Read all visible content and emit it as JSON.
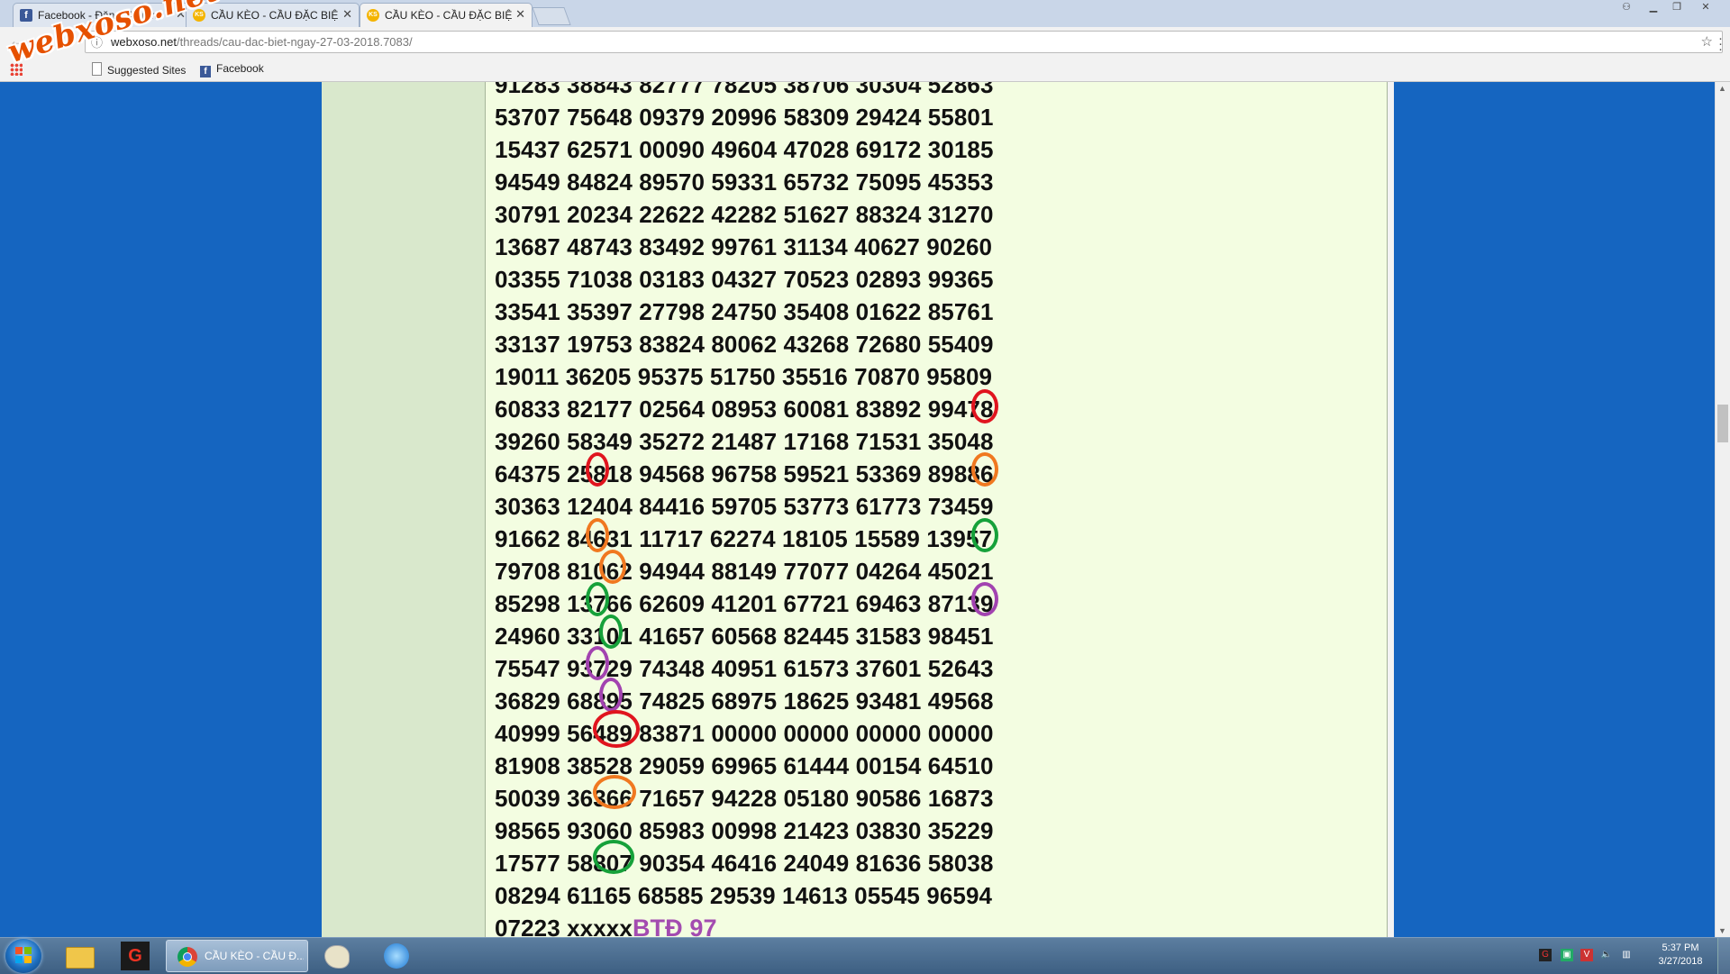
{
  "tabs": [
    {
      "icon": "facebook-icon",
      "title": "Facebook - Đăng nhập h",
      "active": false
    },
    {
      "icon": "ks-icon",
      "title": "CẦU KÈO - CẦU ĐẶC BIỆ",
      "active": false
    },
    {
      "icon": "ks-icon",
      "title": "CẦU KÈO - CẦU ĐẶC BIỆ",
      "active": true
    }
  ],
  "address": {
    "host": "webxoso.net",
    "path": "/threads/cau-dac-biet-ngay-27-03-2018.7083/"
  },
  "bookmarks": {
    "suggested": "Suggested Sites",
    "facebook": "Facebook"
  },
  "watermark": "webxoso.net",
  "number_rows": [
    "91283 38843 82777 78205 38706 30304 52863",
    "53707 75648 09379 20996 58309 29424 55801",
    "15437 62571 00090 49604 47028 69172 30185",
    "94549 84824 89570 59331 65732 75095 45353",
    "30791 20234 22622 42282 51627 88324 31270",
    "13687 48743 83492 99761 31134 40627 90260",
    "03355 71038 03183 04327 70523 02893 99365",
    "33541 35397 27798 24750 35408 01622 85761",
    "33137 19753 83824 80062 43268 72680 55409",
    "19011 36205 95375 51750 35516 70870 95809",
    "60833 82177 02564 08953 60081 83892 99478",
    "39260 58349 35272 21487 17168 71531 35048",
    "64375 25818 94568 96758 59521 53369 89886",
    "30363 12404 84416 59705 53773 61773 73459",
    "91662 84631 11717 62274 18105 15589 13957",
    "79708 81062 94944 88149 77077 04264 45021",
    "85298 13766 62609 41201 67721 69463 87139",
    "24960 33101 41657 60568 82445 31583 98451",
    "75547 93729 74348 40951 61573 37601 52643",
    "36829 68895 74825 68975 18625 93481 49568",
    "40999 56489 83871 00000 00000 00000 00000",
    "81908 38528 29059 69965 61444 00154 64510",
    "50039 36366 71657 94228 05180 90586 16873",
    "98565 93060 85983 00998 21423 03830 35229",
    "17577 58807 90354 46416 24049 81636 58038",
    "08294 61165 68585 29539 14613 05545 96594"
  ],
  "last_line": {
    "numbers": "07223 xxxxx",
    "tag": "BTĐ 97"
  },
  "highlight_colors": {
    "red": "#e0141e",
    "orange": "#f07820",
    "green": "#16a13a",
    "purple": "#a243b0"
  },
  "taskbar": {
    "chrome_label": "CẦU KÈO - CẦU Đ...",
    "time": "5:37 PM",
    "date": "3/27/2018"
  }
}
